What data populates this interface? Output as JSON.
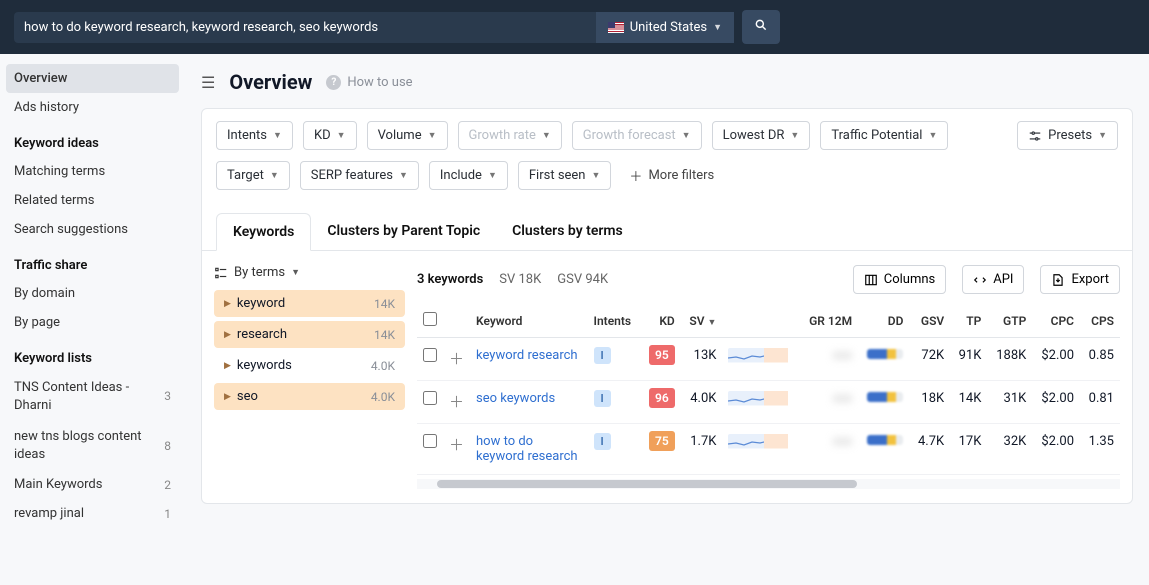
{
  "search": {
    "value": "how to do keyword research, keyword research, seo keywords",
    "country": "United States"
  },
  "sidebar": {
    "overview": "Overview",
    "ads_history": "Ads history",
    "keyword_ideas_head": "Keyword ideas",
    "matching_terms": "Matching terms",
    "related_terms": "Related terms",
    "search_suggestions": "Search suggestions",
    "traffic_share_head": "Traffic share",
    "by_domain": "By domain",
    "by_page": "By page",
    "keyword_lists_head": "Keyword lists",
    "lists": [
      {
        "label": "TNS Content Ideas - Dharni",
        "count": "3"
      },
      {
        "label": "new tns blogs content ideas",
        "count": "8"
      },
      {
        "label": "Main Keywords",
        "count": "2"
      },
      {
        "label": "revamp jinal",
        "count": "1"
      }
    ]
  },
  "page": {
    "title": "Overview",
    "how_to_use": "How to use"
  },
  "filters": {
    "intents": "Intents",
    "kd": "KD",
    "volume": "Volume",
    "growth_rate": "Growth rate",
    "growth_forecast": "Growth forecast",
    "lowest_dr": "Lowest DR",
    "traffic_potential": "Traffic Potential",
    "presets": "Presets",
    "target": "Target",
    "serp_features": "SERP features",
    "include": "Include",
    "first_seen": "First seen",
    "more_filters": "More filters"
  },
  "tabs": {
    "keywords": "Keywords",
    "clusters_parent": "Clusters by Parent Topic",
    "clusters_terms": "Clusters by terms"
  },
  "terms": {
    "by_terms_label": "By terms",
    "items": [
      {
        "label": "keyword",
        "count": "14K",
        "on": true
      },
      {
        "label": "research",
        "count": "14K",
        "on": true
      },
      {
        "label": "keywords",
        "count": "4.0K",
        "on": false
      },
      {
        "label": "seo",
        "count": "4.0K",
        "on": true
      }
    ]
  },
  "results": {
    "count_label": "3 keywords",
    "sv_label": "SV 18K",
    "gsv_label": "GSV 94K",
    "columns_btn": "Columns",
    "api_btn": "API",
    "export_btn": "Export",
    "headers": {
      "keyword": "Keyword",
      "intents": "Intents",
      "kd": "KD",
      "sv": "SV",
      "gr12m": "GR 12M",
      "dd": "DD",
      "gsv": "GSV",
      "tp": "TP",
      "gtp": "GTP",
      "cpc": "CPC",
      "cps": "CPS"
    },
    "rows": [
      {
        "keyword": "keyword research",
        "intent": "I",
        "kd": "95",
        "kd_class": "kd-red",
        "sv": "13K",
        "gsv": "72K",
        "tp": "91K",
        "gtp": "188K",
        "cpc": "$2.00",
        "cps": "0.85"
      },
      {
        "keyword": "seo keywords",
        "intent": "I",
        "kd": "96",
        "kd_class": "kd-red",
        "sv": "4.0K",
        "gsv": "18K",
        "tp": "14K",
        "gtp": "31K",
        "cpc": "$2.00",
        "cps": "0.81"
      },
      {
        "keyword": "how to do keyword research",
        "intent": "I",
        "kd": "75",
        "kd_class": "kd-org",
        "sv": "1.7K",
        "gsv": "4.7K",
        "tp": "17K",
        "gtp": "32K",
        "cpc": "$2.00",
        "cps": "1.35"
      }
    ]
  }
}
